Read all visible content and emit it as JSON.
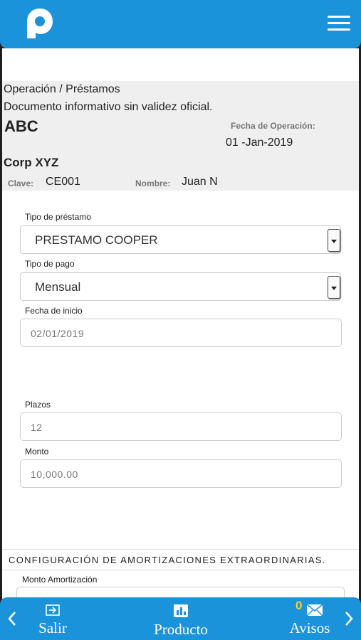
{
  "header": {
    "logo_icon": "p-logo-icon",
    "menu_icon": "hamburger-icon",
    "brand_color": "#1b93db"
  },
  "info": {
    "breadcrumb": "Operación / Préstamos",
    "disclaimer": "Documento informativo sin validez oficial.",
    "company": "ABC",
    "operation_date_label": "Fecha de Operación:",
    "operation_date": "01 -Jan-2019",
    "client": "Corp XYZ",
    "clave_label": "Clave:",
    "clave": "CE001",
    "nombre_label": "Nombre:",
    "nombre": "Juan N"
  },
  "form": {
    "loan_type_label": "Tipo de préstamo",
    "loan_type": "PRESTAMO COOPER",
    "payment_type_label": "Tipo de pago",
    "payment_type": "Mensual",
    "start_date_label": "Fecha de inicio",
    "start_date": "02/01/2019",
    "terms_label": "Plazos",
    "terms": "12",
    "amount_label": "Monto",
    "amount": "10,000.00"
  },
  "amortization": {
    "section_title": "CONFIGURACIÓN DE AMORTIZACIONES EXTRAORDINARIAS.",
    "amount_label": "Monto Amortización"
  },
  "bottom_nav": {
    "exit_label": "Salir",
    "product_label": "Producto",
    "notices_label": "Avisos",
    "notices_count": "0",
    "badge_color": "#f3d23a"
  }
}
